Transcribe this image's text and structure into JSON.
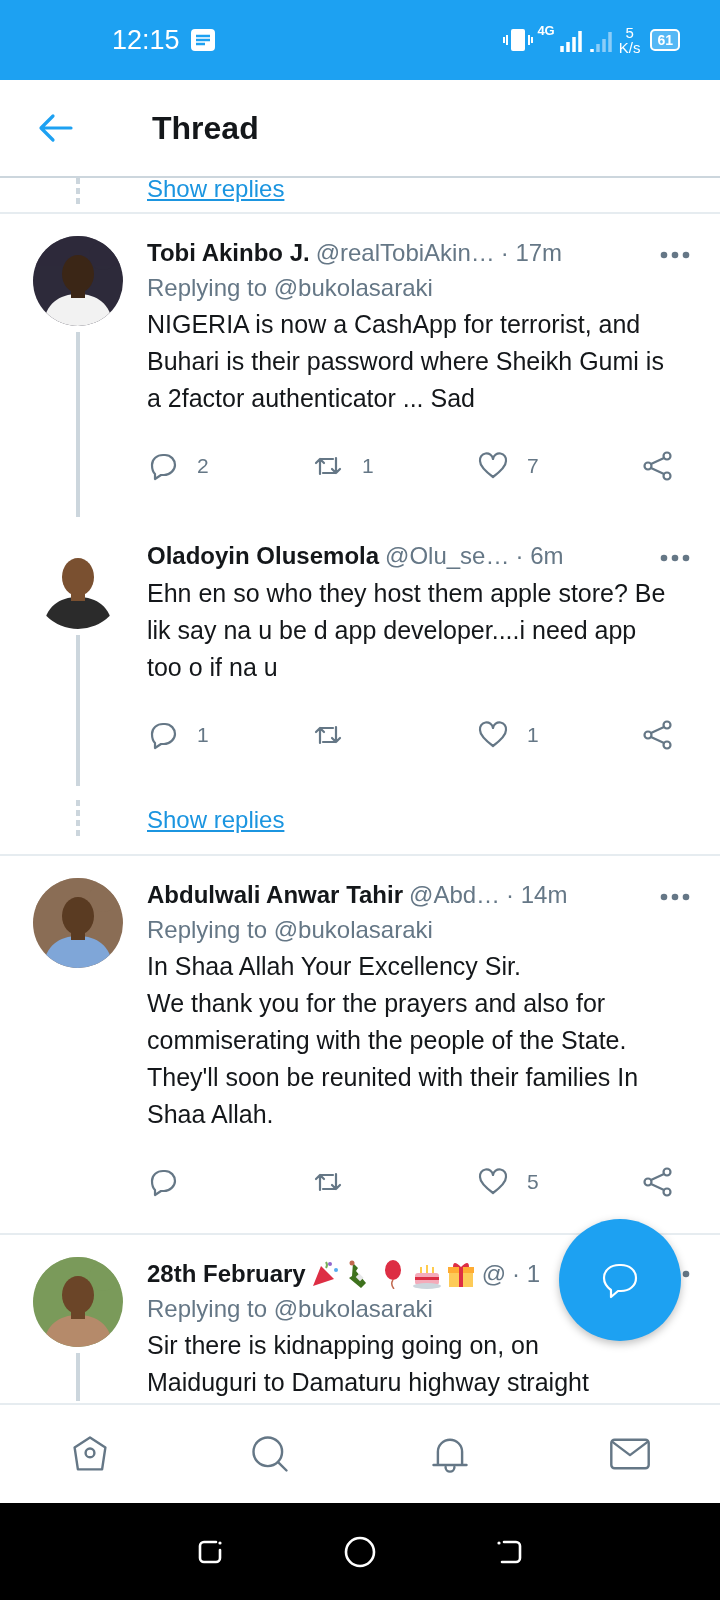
{
  "status_bar": {
    "time": "12:15",
    "network": "4G",
    "speed_value": "5",
    "speed_unit": "K/s",
    "battery": "61"
  },
  "header": {
    "title": "Thread"
  },
  "top_show_replies": "Show replies",
  "tweets": [
    {
      "name": "Tobi Akinbo J.",
      "handle": "@realTobiAkin…",
      "time": "· 17m",
      "replying_prefix": "Replying to ",
      "replying_to": "@bukolasaraki",
      "text": "NIGERIA is now a CashApp for terrorist, and Buhari is their password where Sheikh Gumi is a 2factor authenticator ... Sad",
      "reply_count": "2",
      "retweet_count": "1",
      "like_count": "7",
      "thread_line": true,
      "separator_after": false
    },
    {
      "name": "Oladoyin Olusemola",
      "handle": "@Olu_se…",
      "time": "· 6m",
      "text": "Ehn en so who they host them apple store? Be lik say na u be d app developer....i need app too o if na u",
      "reply_count": "1",
      "like_count": "1",
      "thread_line": true,
      "show_replies": "Show replies",
      "separator_after": true
    },
    {
      "name": "Abdulwali Anwar Tahir",
      "handle": "@Abd…",
      "time": "· 14m",
      "replying_prefix": "Replying to ",
      "replying_to": "@bukolasaraki",
      "text": "In Shaa Allah Your Excellency Sir.\nWe thank you for the prayers and also for commiserating with the people of the State.\nThey'll soon be reunited with their families In Shaa Allah.",
      "like_count": "5",
      "thread_line": false,
      "separator_after": true
    },
    {
      "name": "28th February",
      "emoji": [
        {
          "kind": "party-popper"
        },
        {
          "kind": "bottle"
        },
        {
          "kind": "balloon"
        },
        {
          "kind": "cake"
        },
        {
          "kind": "gift"
        }
      ],
      "handle": "@",
      "time": "· 1",
      "replying_prefix": "Replying to ",
      "replying_to": "@bukolasaraki",
      "text": "Sir there is kidnapping going on, on\nMaiduguri to Damaturu highway straight",
      "thread_line": true,
      "separator_after": false
    }
  ],
  "bottom_nav": [
    {
      "kind": "home"
    },
    {
      "kind": "search"
    },
    {
      "kind": "notifications"
    },
    {
      "kind": "messages"
    }
  ]
}
